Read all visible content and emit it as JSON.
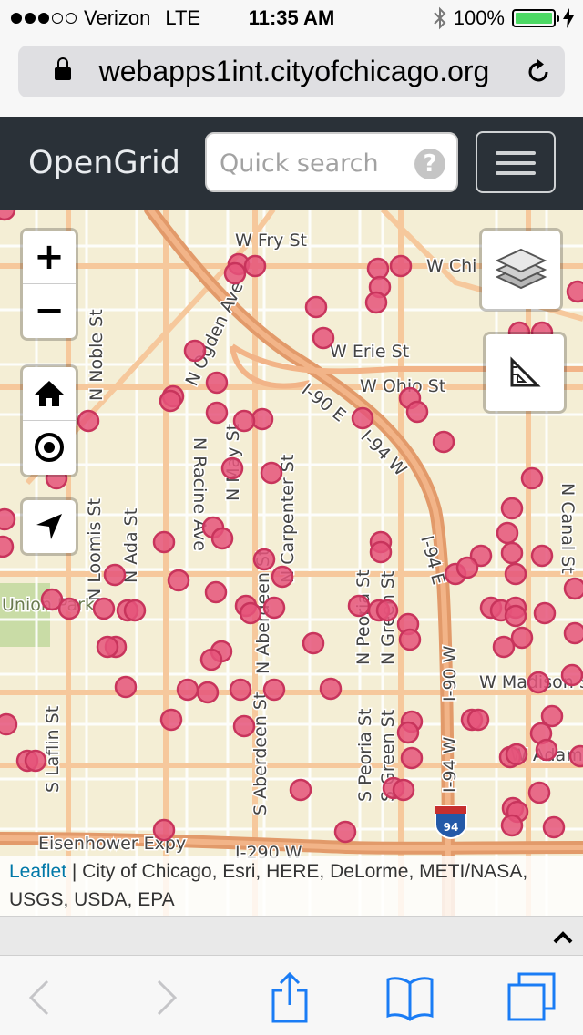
{
  "status_bar": {
    "carrier": "Verizon",
    "network": "LTE",
    "time": "11:35 AM",
    "battery": "100%",
    "signal_bars_filled": 3,
    "signal_bars_total": 5,
    "battery_fill_fraction": 1.0
  },
  "browser": {
    "url": "webapps1int.cityofchicago.org"
  },
  "navbar": {
    "brand": "OpenGrid",
    "search_placeholder": "Quick search",
    "help_label": "?"
  },
  "map": {
    "street_labels": [
      "W Fry St",
      "W Chi",
      "W Erie St",
      "W Ohio St",
      "I-90 E",
      "I-94 W",
      "I-94 E",
      "I-90 W",
      "I-94 W",
      "N Ogden Ave",
      "N Noble St",
      "N Racine Ave",
      "N May St",
      "N Carpenter St",
      "N Loomis St",
      "N Ada St",
      "N Aberdeen St",
      "N Peoria St",
      "N Green St",
      "N Canal St",
      "S Laflin St",
      "S Aberdeen St",
      "S Peoria St",
      "S Green St",
      "Union Park",
      "W Madison St",
      "W Adams St",
      "Eisenhower Expy",
      "I-290 W",
      "94"
    ],
    "marker_color": "#e5547a",
    "controls": {
      "zoom_in": "+",
      "zoom_out": "−"
    },
    "attribution": {
      "leaflet": "Leaflet",
      "sources": " | City of Chicago, Esri, HERE, DeLorme, METI/NASA, USGS, USDA, EPA"
    }
  },
  "icons": {
    "lock": "lock-icon",
    "reload": "reload-icon",
    "help": "help-icon",
    "menu": "hamburger-icon",
    "layers": "layers-icon",
    "measure": "ruler-triangle-icon",
    "home": "home-icon",
    "locate": "target-icon",
    "navigate": "navigation-arrow-icon",
    "caret": "caret-up-icon",
    "back": "back-chevron-icon",
    "forward": "forward-chevron-icon",
    "share": "share-icon",
    "bookmarks": "book-icon",
    "tabs": "tabs-icon"
  }
}
